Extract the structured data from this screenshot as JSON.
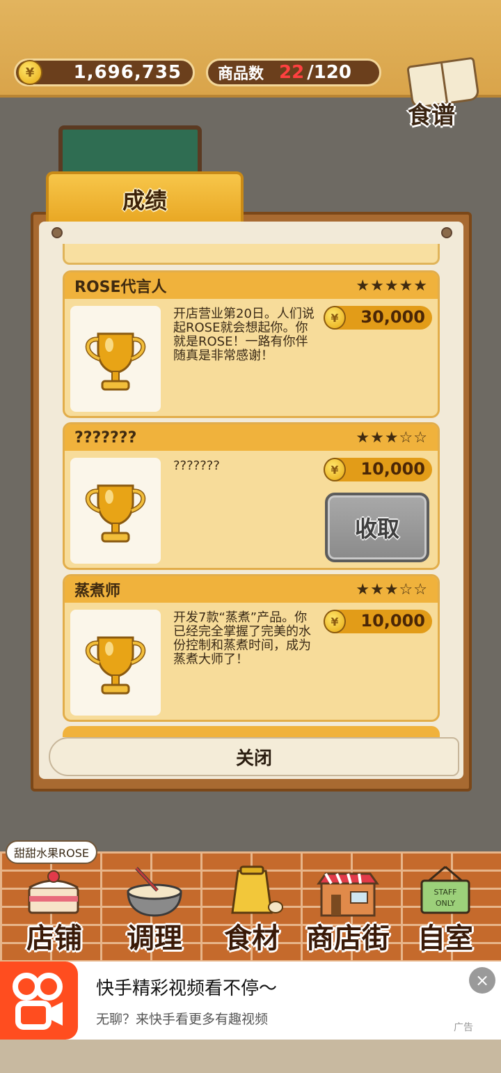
{
  "header": {
    "currency_symbol": "¥",
    "money": "1,696,735",
    "goods_label": "商品数",
    "goods_count": "22",
    "goods_max": "/120",
    "recipe_label": "食谱"
  },
  "panel": {
    "tab_title": "成绩",
    "close_label": "关闭"
  },
  "achievements": [
    {
      "title": "ROSE代言人",
      "stars": "★★★★★",
      "rating": 5,
      "description": "开店营业第20日。人们说起ROSE就会想起你。你就是ROSE！一路有你伴随真是非常感谢！",
      "reward": "30,000",
      "collect_label": ""
    },
    {
      "title": "???????",
      "stars": "★★★☆☆",
      "rating": 3,
      "description": "???????",
      "reward": "10,000",
      "collect_label": "收取"
    },
    {
      "title": "蒸煮师",
      "stars": "★★★☆☆",
      "rating": 3,
      "description": "开发7款“蒸煮”产品。你已经完全掌握了完美的水份控制和蒸煮时间，成为蒸煮大师了！",
      "reward": "10,000",
      "collect_label": ""
    }
  ],
  "bottom_nav": {
    "shop_name": "甜甜水果ROSE",
    "items": [
      {
        "label": "店铺",
        "icon": "cake-icon"
      },
      {
        "label": "调理",
        "icon": "mixing-bowl-icon"
      },
      {
        "label": "食材",
        "icon": "flour-sack-icon"
      },
      {
        "label": "商店街",
        "icon": "shop-street-icon"
      },
      {
        "label": "自室",
        "icon": "staff-only-sign-icon"
      }
    ],
    "staff_sign": "STAFF ONLY"
  },
  "ad": {
    "title": "快手精彩视频看不停～",
    "subtitle": "无聊？来快手看更多有趣视频",
    "tag": "广告",
    "close": "×"
  },
  "colors": {
    "accent": "#f0b23c",
    "brick": "#c56a2c",
    "goods_count": "#ff4040",
    "ad_brand": "#ff4d1f"
  }
}
